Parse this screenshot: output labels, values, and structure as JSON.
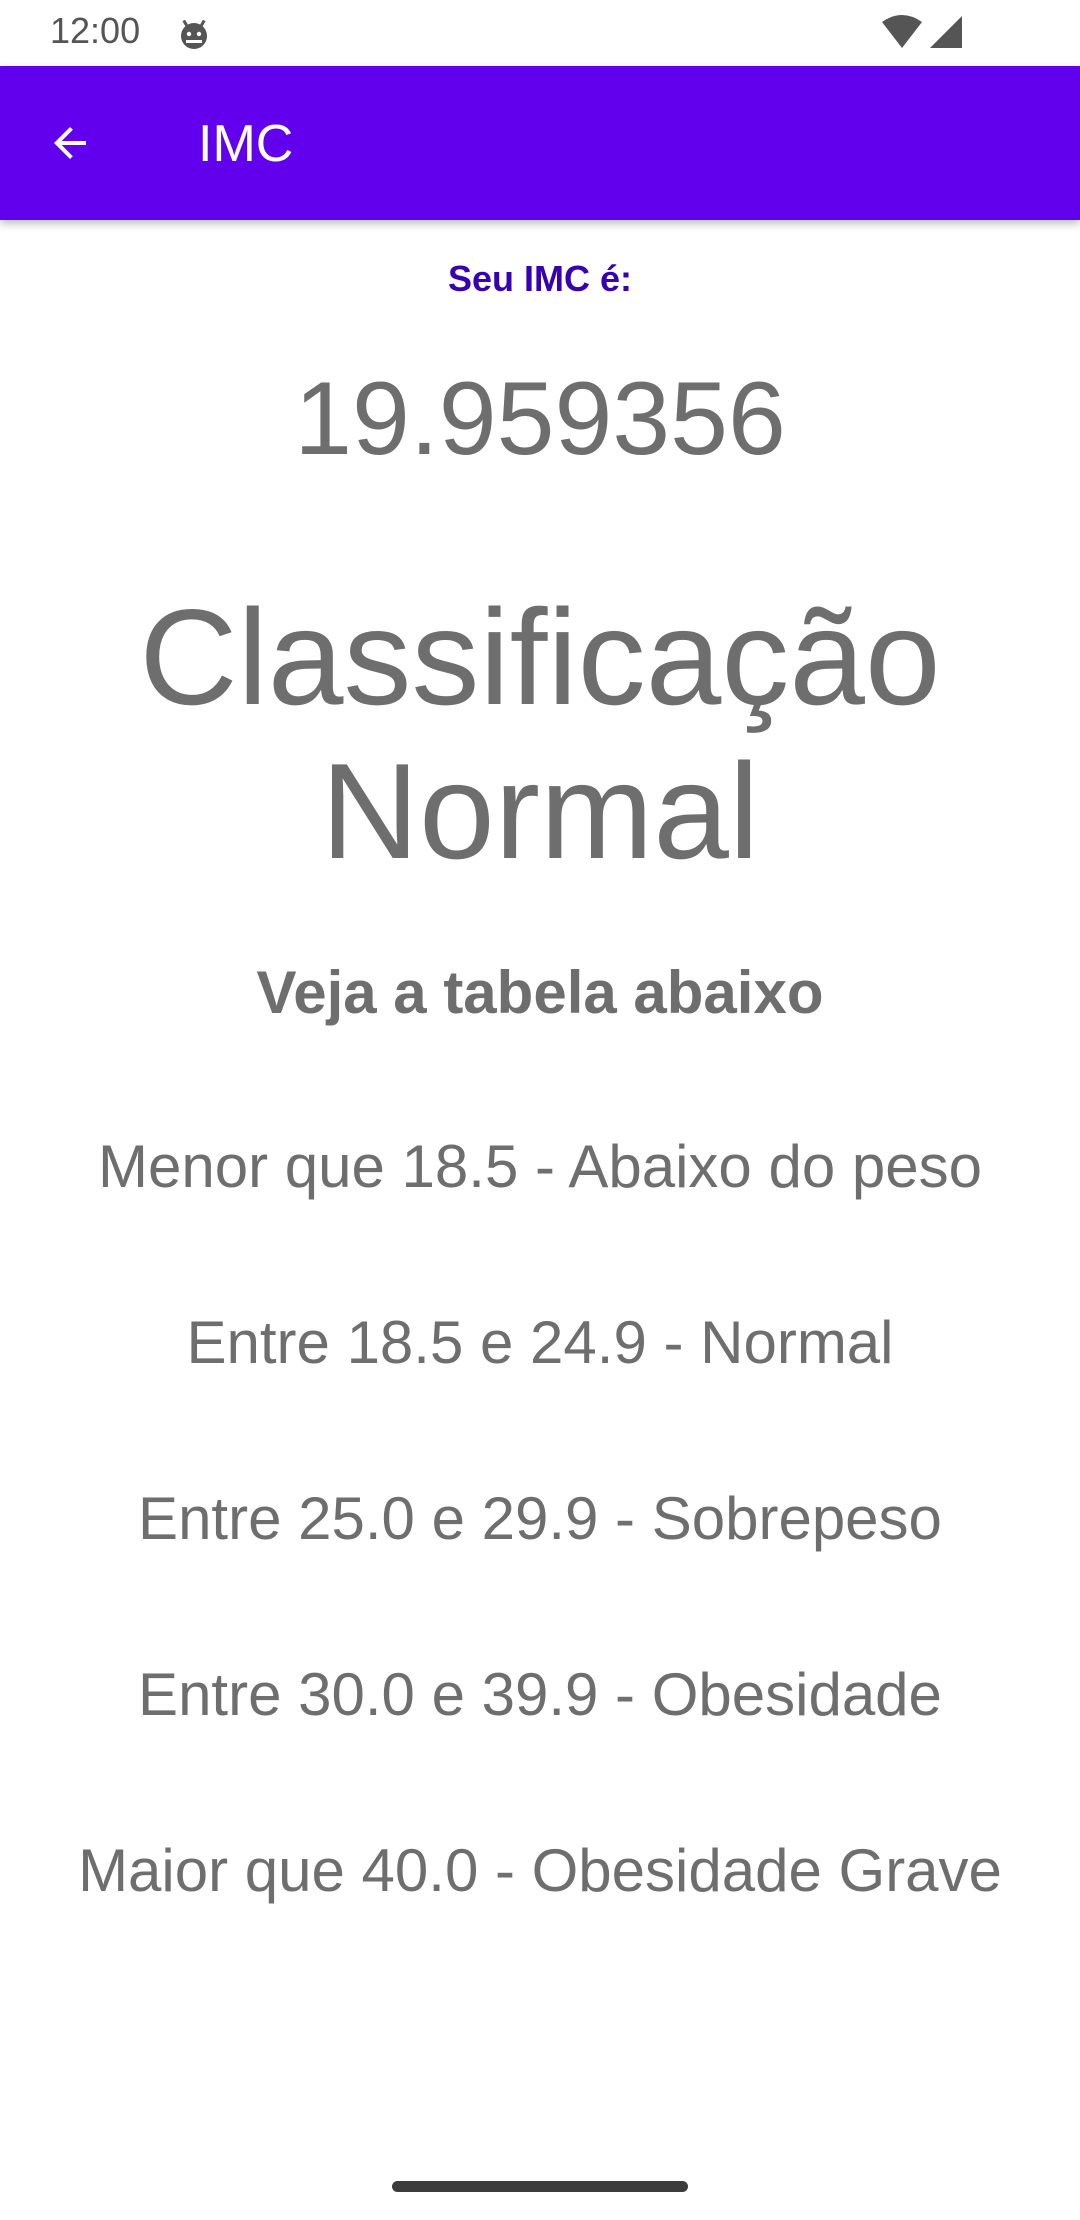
{
  "status_bar": {
    "time": "12:00",
    "icons": [
      "android-icon",
      "wifi-icon",
      "signal-icon"
    ]
  },
  "app_bar": {
    "title": "IMC",
    "back_icon": "arrow-back-icon",
    "color": "#6200ee"
  },
  "result": {
    "label": "Seu IMC é:",
    "value": "19.959356",
    "classification_line1": "Classificação",
    "classification_line2": "Normal"
  },
  "table": {
    "heading": "Veja a tabela abaixo",
    "rows": [
      "Menor que 18.5 - Abaixo do peso",
      "Entre 18.5 e 24.9 - Normal",
      "Entre 25.0 e 29.9 - Sobrepeso",
      "Entre 30.0 e 39.9 - Obesidade",
      "Maior que 40.0 - Obesidade Grave"
    ]
  },
  "colors": {
    "accent": "#6200ee",
    "label": "#3700b3",
    "text": "#6e6e6e"
  }
}
